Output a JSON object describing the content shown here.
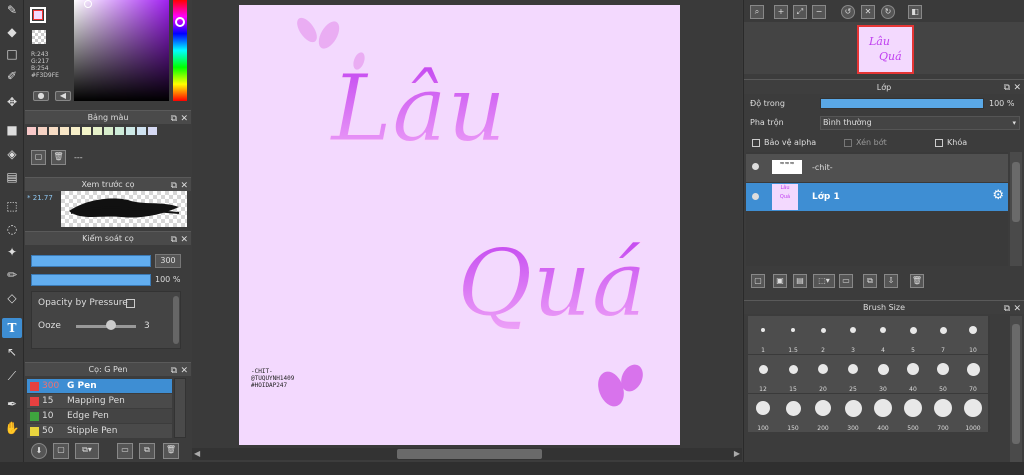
{
  "color": {
    "r": "R:243",
    "g": "G:217",
    "b": "B:254",
    "hex": "#F3D9FE",
    "foreground": "#f3d9fe",
    "accent": "#3e8ed3"
  },
  "palette": {
    "title": "Bảng màu",
    "list_value": "---",
    "swatches": [
      "#f8c9c9",
      "#f6d2c3",
      "#f7dcc4",
      "#f8e6c6",
      "#f7efc9",
      "#f4f5c9",
      "#e6f1c9",
      "#d7edcb",
      "#cdebd8",
      "#cde9e7",
      "#cfe2f1",
      "#d5d9f3"
    ]
  },
  "brush_preview": {
    "title": "Xem trước cọ",
    "size": "21.77"
  },
  "brush_control": {
    "title": "Kiểm soát cọ",
    "size_value": "300",
    "opacity_value": "100 %",
    "opacity_by_pressure_label": "Opacity by Pressure",
    "ooze_label": "Ooze",
    "ooze_value": "3"
  },
  "brush_list": {
    "title": "Cọ: G Pen",
    "items": [
      {
        "size": "300",
        "name": "G Pen",
        "color": "#e84040",
        "selected": true
      },
      {
        "size": "15",
        "name": "Mapping Pen",
        "color": "#e84040",
        "selected": false
      },
      {
        "size": "10",
        "name": "Edge Pen",
        "color": "#3ea53e",
        "selected": false
      },
      {
        "size": "50",
        "name": "Stipple Pen",
        "color": "#e8d43e",
        "selected": false
      }
    ]
  },
  "canvas": {
    "text_line1": "Lâu",
    "text_line2": "Quá",
    "signature": [
      "-CHIT-",
      "@TUQUYNH1409",
      "#HOIDAP247"
    ]
  },
  "layers": {
    "title": "Lớp",
    "opacity_label": "Độ trong",
    "opacity_value": "100 %",
    "opacity_fraction": 1.0,
    "blend_label": "Pha trộn",
    "blend_value": "Bình thường",
    "protect_alpha": "Bảo vệ alpha",
    "clipping": "Xén bớt",
    "lock": "Khóa",
    "items": [
      {
        "name": "-chit-",
        "selected": false
      },
      {
        "name": "Lớp 1",
        "selected": true
      }
    ]
  },
  "brush_size": {
    "title": "Brush Size",
    "sizes": [
      "1",
      "1.5",
      "2",
      "3",
      "4",
      "5",
      "7",
      "10",
      "12",
      "15",
      "20",
      "25",
      "30",
      "40",
      "50",
      "70",
      "100",
      "150",
      "200",
      "300",
      "400",
      "500",
      "700",
      "1000"
    ]
  }
}
